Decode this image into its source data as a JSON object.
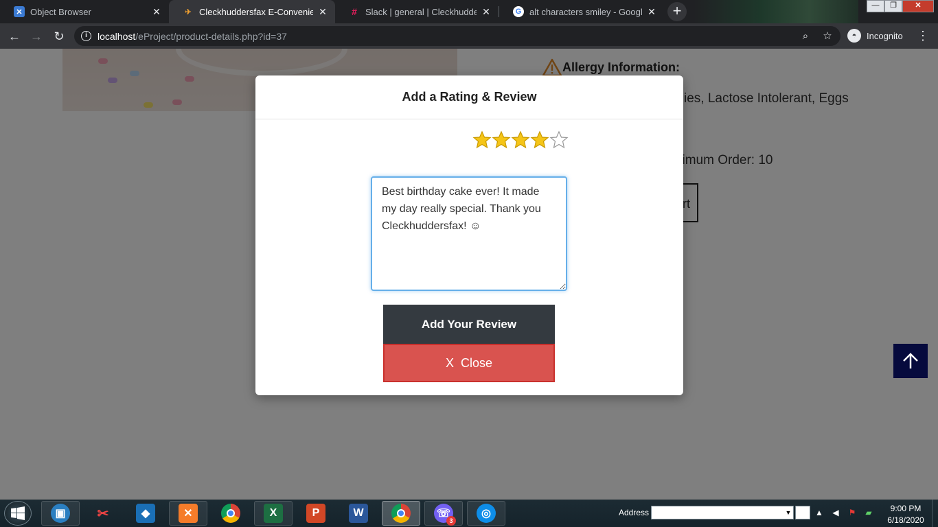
{
  "browser": {
    "tabs": [
      {
        "title": "Object Browser",
        "active": false
      },
      {
        "title": "Cleckhuddersfax E-Convenient Store",
        "active": true
      },
      {
        "title": "Slack | general | Cleckhuddersfax",
        "active": false
      },
      {
        "title": "alt characters smiley - Google Search",
        "active": false
      }
    ],
    "new_tab": "+",
    "url_host": "localhost",
    "url_path": "/eProject/product-details.php?id=37",
    "profile_label": "Incognito"
  },
  "page": {
    "allergy_heading": "Allergy Information:",
    "allergy_text_visible": "ies, Lactose Intolerant, Eggs",
    "max_order_visible": "ximum Order: 10",
    "cart_button_visible": "rt"
  },
  "modal": {
    "title": "Add a Rating & Review",
    "rating": 4,
    "rating_max": 5,
    "review_text": "Best birthday cake ever! It made my day really special. Thank you Cleckhuddersfax! ☺",
    "add_button": "Add Your Review",
    "close_button_x": "X",
    "close_button_label": "Close"
  },
  "taskbar": {
    "apps": [
      "file-explorer",
      "snipping-tool",
      "virtualbox",
      "xampp",
      "chrome",
      "excel",
      "powerpoint",
      "word",
      "chrome",
      "viber",
      "teamviewer"
    ],
    "viber_badge": "3",
    "address_label": "Address",
    "time": "9:00 PM",
    "date": "6/18/2020"
  },
  "colors": {
    "modal_add_button": "#343a40",
    "modal_close_button": "#d9534f",
    "star_filled": "#f5c518",
    "scroll_top_button": "#060a3d",
    "textarea_focus": "#66afe9"
  }
}
